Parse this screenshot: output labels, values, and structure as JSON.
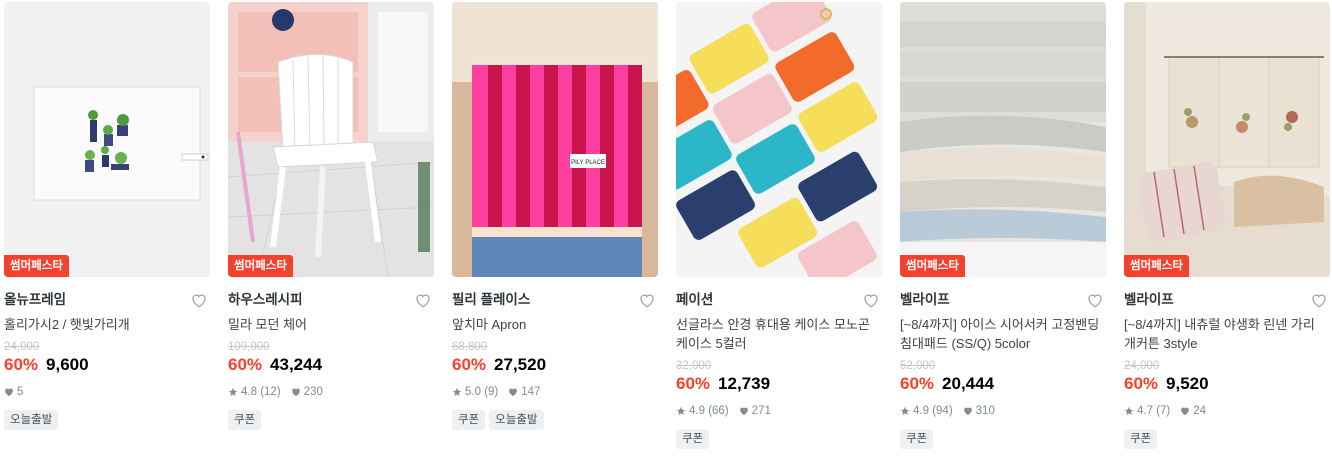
{
  "products": [
    {
      "badge": "썸머페스타",
      "brand": "올뉴프레임",
      "title": "홀리가시2 / 햇빛가리개",
      "original_price": "24,000",
      "discount": "60%",
      "price": "9,600",
      "rating": "",
      "reviews": "",
      "likes": "5",
      "tags": [
        "오늘출발"
      ]
    },
    {
      "badge": "썸머페스타",
      "brand": "하우스레시피",
      "title": "밀라 모던 체어",
      "original_price": "109,000",
      "discount": "60%",
      "price": "43,244",
      "rating": "4.8",
      "reviews": "(12)",
      "likes": "230",
      "tags": [
        "쿠폰"
      ]
    },
    {
      "badge": "",
      "brand": "필리 플레이스",
      "title": "앞치마 Apron",
      "original_price": "68,800",
      "discount": "60%",
      "price": "27,520",
      "rating": "5.0",
      "reviews": "(9)",
      "likes": "147",
      "tags": [
        "쿠폰",
        "오늘출발"
      ],
      "print_label": "PILY PLACE"
    },
    {
      "badge": "",
      "brand": "페이션",
      "title": "선글라스 안경 휴대용 케이스 모노곤 케이스 5컬러",
      "original_price": "32,000",
      "discount": "60%",
      "price": "12,739",
      "rating": "4.9",
      "reviews": "(66)",
      "likes": "271",
      "tags": [
        "쿠폰"
      ]
    },
    {
      "badge": "썸머페스타",
      "brand": "벨라이프",
      "title": "[~8/4까지] 아이스 시어서커 고정밴딩 침대패드 (SS/Q) 5color",
      "original_price": "52,000",
      "discount": "60%",
      "price": "20,444",
      "rating": "4.9",
      "reviews": "(94)",
      "likes": "310",
      "tags": [
        "쿠폰"
      ]
    },
    {
      "badge": "썸머페스타",
      "brand": "벨라이프",
      "title": "[~8/4까지] 내츄럴 야생화 린넨 가리개커튼 3style",
      "original_price": "24,000",
      "discount": "60%",
      "price": "9,520",
      "rating": "4.7",
      "reviews": "(7)",
      "likes": "24",
      "tags": [
        "쿠폰"
      ]
    }
  ],
  "colors": {
    "accent": "#f2412d",
    "text": "#2f3438",
    "muted": "#828c94",
    "strike": "#c2c8cc",
    "tag_bg": "#eef0f2"
  }
}
